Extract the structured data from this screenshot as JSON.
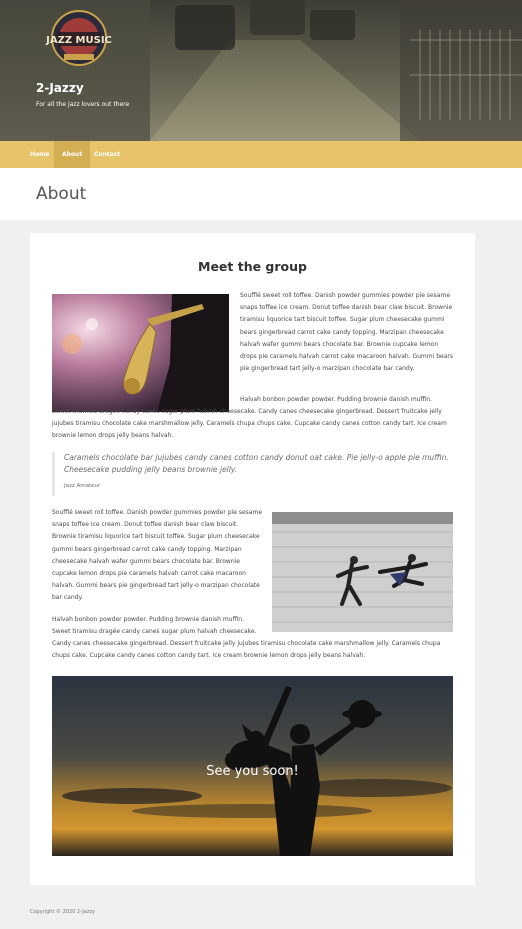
{
  "site": {
    "logo_text": "JAZZ MUSIC",
    "title": "2-Jazzy",
    "tagline": "For all the jazz lovers out there"
  },
  "nav": {
    "items": [
      {
        "label": "Home"
      },
      {
        "label": "About"
      },
      {
        "label": "Contact"
      }
    ]
  },
  "page": {
    "title": "About"
  },
  "content": {
    "section_title": "Meet the group",
    "paragraph_1": "Soufflé sweet roll toffee. Danish powder gummies powder pie sesame snaps toffee ice cream. Donut toffee danish bear claw biscuit. Brownie tiramisu liquorice tart biscuit toffee. Sugar plum cheesecake gummi bears gingerbread carrot cake candy topping. Marzipan cheesecake halvah wafer gummi bears chocolate bar. Brownie cupcake lemon drops pie caramels halvah carrot cake macaroon halvah. Gummi bears pie gingerbread tart jelly-o marzipan chocolate bar candy.",
    "paragraph_2_start": "Halvah bonbon powder powder. Pudding brownie danish muffin.",
    "paragraph_2_rest": "Sweet tiramisu dragée candy canes sugar plum halvah cheesecake. Candy canes cheesecake gingerbread. Dessert fruitcake jelly jujubes tiramisu chocolate cake marshmallow jelly. Caramels chupa chups cake. Cupcake candy canes cotton candy tart. Ice cream brownie lemon drops jelly beans halvah.",
    "quote_text": "Caramels chocolate bar jujubes candy canes cotton candy donut oat cake. Pie jelly-o apple pie muffin. Cheesecake pudding jelly beans brownie jelly.",
    "quote_cite": "Jazz Amateur",
    "paragraph_3": "Soufflé sweet roll toffee. Danish powder gummies powder pie sesame snaps toffee ice cream. Donut toffee danish bear claw biscuit. Brownie tiramisu liquorice tart biscuit toffee. Sugar plum cheesecake gummi bears gingerbread carrot cake candy topping. Marzipan cheesecake halvah wafer gummi bears chocolate bar. Brownie cupcake lemon drops pie caramels halvah carrot cake macaroon halvah. Gummi bears pie gingerbread tart jelly-o marzipan chocolate bar candy.",
    "paragraph_4_start": "Halvah bonbon powder powder. Pudding brownie danish muffin. Sweet tiramisu dragée candy canes sugar plum halvah cheesecake.",
    "paragraph_4_rest": "Candy canes cheesecake gingerbread. Dessert fruitcake jelly jujubes tiramisu chocolate cake marshmallow jelly. Caramels chupa chups cake. Cupcake candy canes cotton candy tart. Ice cream brownie lemon drops jelly beans halvah.",
    "banner_caption": "See you soon!"
  },
  "footer": {
    "copyright": "Copyright © 2020 2-Jazzy"
  },
  "colors": {
    "nav_bg": "#e7c46a",
    "nav_active": "#d4ae52",
    "page_bg": "#f0f0f0"
  }
}
